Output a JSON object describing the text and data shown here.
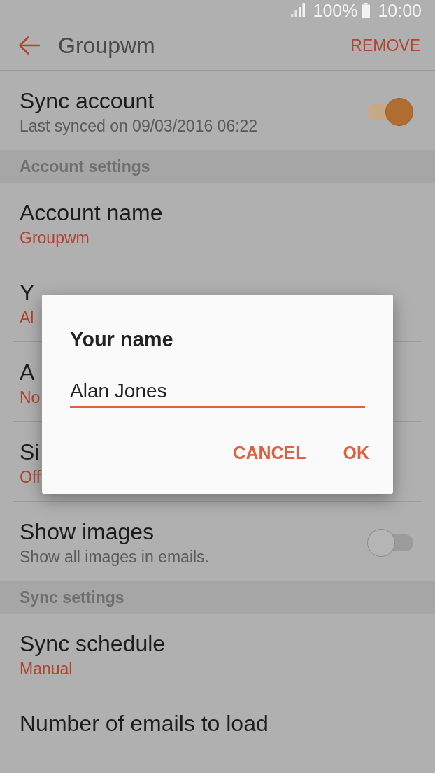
{
  "status_bar": {
    "battery_percent": "100%",
    "time": "10:00"
  },
  "app_bar": {
    "title": "Groupwm",
    "action": "REMOVE"
  },
  "settings": [
    {
      "kind": "toggle",
      "title": "Sync account",
      "subtitle": "Last synced on 09/03/2016 06:22",
      "on": true
    },
    {
      "kind": "header",
      "title": "Account settings"
    },
    {
      "kind": "value",
      "title": "Account name",
      "value": "Groupwm"
    },
    {
      "kind": "value",
      "title": "Y",
      "value": "Al"
    },
    {
      "kind": "value",
      "title": "A",
      "value": "No"
    },
    {
      "kind": "value",
      "title": "Si",
      "value": "Off"
    },
    {
      "kind": "toggle",
      "title": "Show images",
      "subtitle": "Show all images in emails.",
      "on": false
    },
    {
      "kind": "header",
      "title": "Sync settings"
    },
    {
      "kind": "value",
      "title": "Sync schedule",
      "value": "Manual"
    },
    {
      "kind": "plain",
      "title": "Number of emails to load"
    }
  ],
  "dialog": {
    "title": "Your name",
    "input_value": "Alan Jones",
    "buttons": [
      "CANCEL",
      "OK"
    ]
  }
}
